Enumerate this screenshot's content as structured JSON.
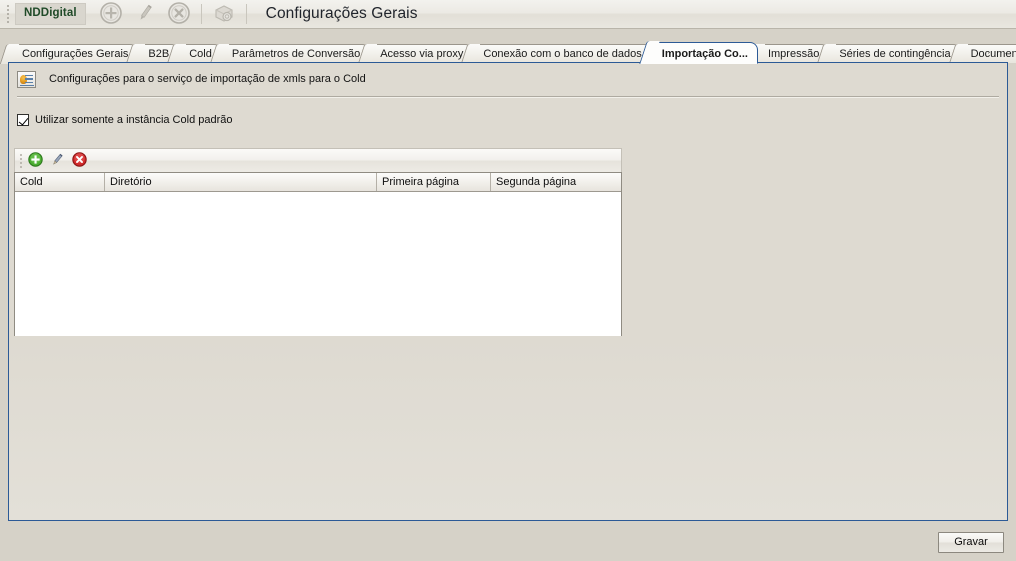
{
  "window": {
    "brand": "NDDigital",
    "title": "Configurações Gerais"
  },
  "toolbar": {
    "buttons": [
      {
        "name": "add-icon",
        "label": "Adicionar",
        "enabled": false
      },
      {
        "name": "edit-pencil-icon",
        "label": "Editar",
        "enabled": false
      },
      {
        "name": "cancel-icon",
        "label": "Cancelar",
        "enabled": false
      },
      {
        "name": "deploy-icon",
        "label": "Implantar",
        "enabled": false
      }
    ]
  },
  "tabs": {
    "items": [
      {
        "label": "Configurações Gerais",
        "active": false
      },
      {
        "label": "B2B",
        "active": false
      },
      {
        "label": "Cold",
        "active": false
      },
      {
        "label": "Parâmetros de Conversão",
        "active": false
      },
      {
        "label": "Acesso via proxy",
        "active": false
      },
      {
        "label": "Conexão com o banco de dados",
        "active": false
      },
      {
        "label": "Importação Co...",
        "active": true
      },
      {
        "label": "Impressão",
        "active": false
      },
      {
        "label": "Séries de contingência",
        "active": false
      },
      {
        "label": "Documentos de",
        "active": false
      }
    ],
    "scroll_prev": "◀",
    "scroll_next": "▶"
  },
  "content": {
    "description": "Configurações para o serviço de importação de xmls para o Cold",
    "checkbox": {
      "label": "Utilizar somente a instância Cold padrão",
      "checked": true
    },
    "grid_toolbar": [
      {
        "name": "grid-add-icon",
        "label": "Adicionar"
      },
      {
        "name": "grid-edit-icon",
        "label": "Editar"
      },
      {
        "name": "grid-delete-icon",
        "label": "Excluir"
      }
    ],
    "grid": {
      "columns": [
        "Cold",
        "Diretório",
        "Primeira página",
        "Segunda página"
      ],
      "rows": []
    }
  },
  "footer": {
    "save_label": "Gravar"
  },
  "colors": {
    "window_bg": "#d6d2c8",
    "panel_border": "#2c5a96",
    "brand_text": "#1f4a28",
    "grid_bg": "#ffffff",
    "add_green": "#3ea03e",
    "delete_red": "#cf2b2b"
  }
}
